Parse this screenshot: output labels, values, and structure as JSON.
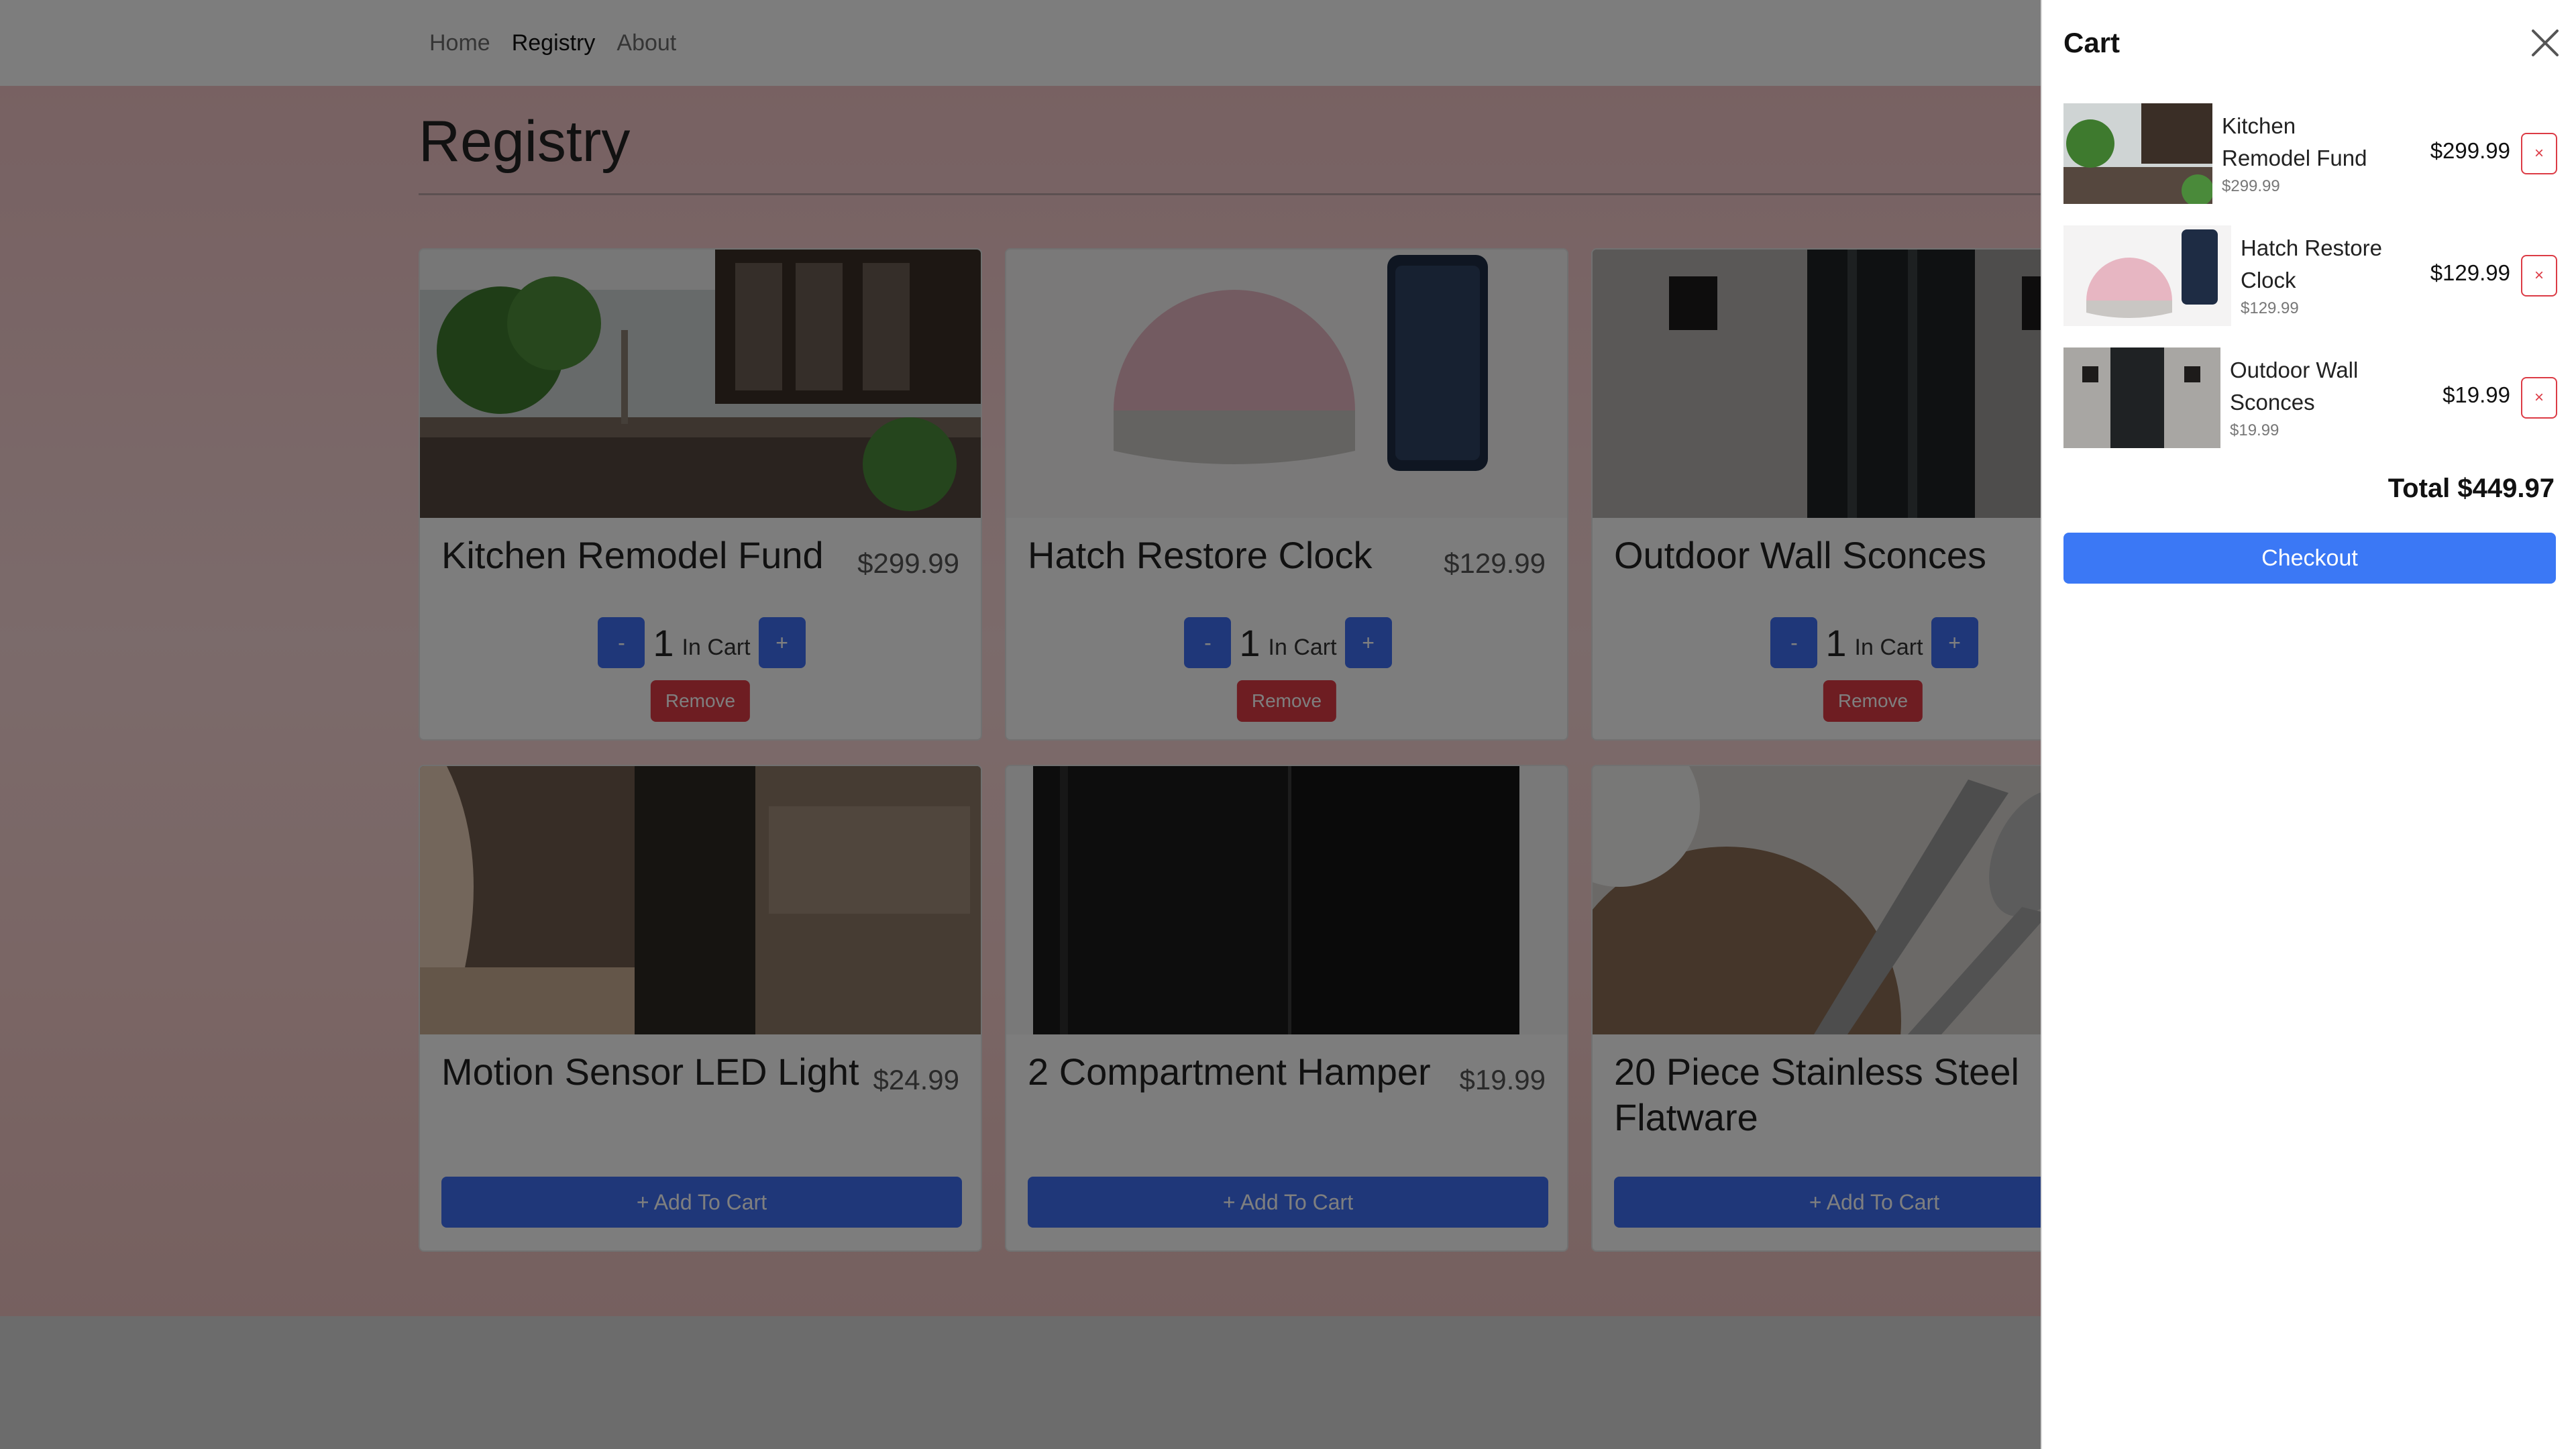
{
  "nav": {
    "links": [
      "Home",
      "Registry",
      "About"
    ],
    "active": "Registry"
  },
  "page": {
    "title": "Registry"
  },
  "products": [
    {
      "name": "Kitchen Remodel Fund",
      "price": "$299.99",
      "qty": "1",
      "in_cart_label": "In Cart",
      "minus": "-",
      "plus": "+",
      "remove": "Remove"
    },
    {
      "name": "Hatch Restore Clock",
      "price": "$129.99",
      "qty": "1",
      "in_cart_label": "In Cart",
      "minus": "-",
      "plus": "+",
      "remove": "Remove"
    },
    {
      "name": "Outdoor Wall Sconces",
      "price": "",
      "qty": "1",
      "in_cart_label": "In Cart",
      "minus": "-",
      "plus": "+",
      "remove": "Remove"
    },
    {
      "name": "Motion Sensor LED Light",
      "price": "$24.99",
      "add": "+ Add To Cart"
    },
    {
      "name": "2 Compartment Hamper",
      "price": "$19.99",
      "add": "+ Add To Cart"
    },
    {
      "name": "20 Piece Stainless Steel Flatware",
      "price": "",
      "add": "+ Add To Cart"
    }
  ],
  "cart": {
    "title": "Cart",
    "items": [
      {
        "name": "Kitchen Remodel Fund",
        "unit_price": "$299.99",
        "price": "$299.99",
        "remove": "×"
      },
      {
        "name": "Hatch Restore Clock",
        "unit_price": "$129.99",
        "price": "$129.99",
        "remove": "×"
      },
      {
        "name": "Outdoor Wall Sconces",
        "unit_price": "$19.99",
        "price": "$19.99",
        "remove": "×"
      }
    ],
    "total": "Total $449.97",
    "checkout": "Checkout"
  },
  "colors": {
    "primary": "#3f6ef2",
    "danger": "#dc3b45",
    "hero_pink": "#f0c3c5"
  }
}
